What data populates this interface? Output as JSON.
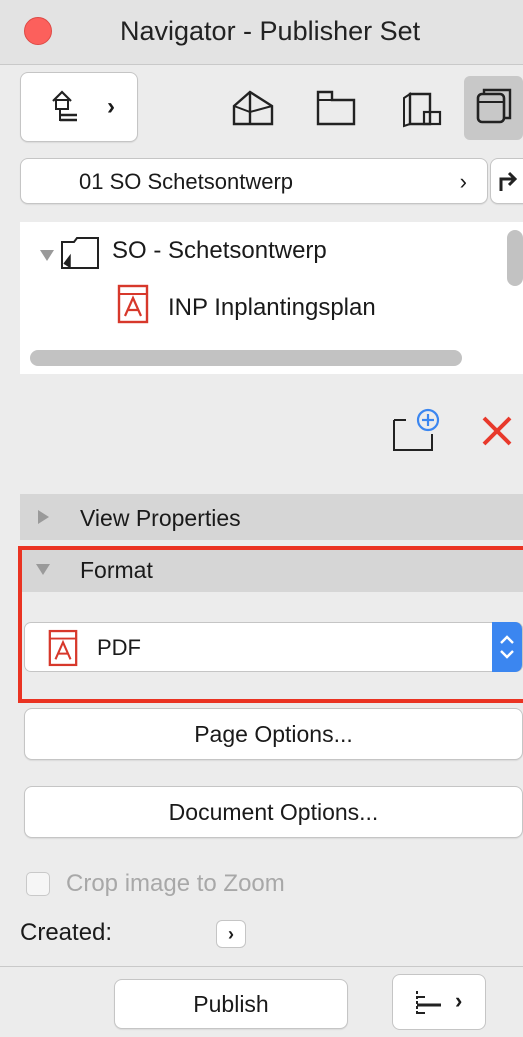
{
  "window": {
    "title": "Navigator - Publisher Set"
  },
  "toolbar": {
    "set_selector_chevron": "›",
    "buttons": [
      {
        "icon": "project-map-icon"
      },
      {
        "icon": "view-map-icon"
      },
      {
        "icon": "layout-book-icon"
      },
      {
        "icon": "publisher-sets-icon",
        "selected": true
      }
    ]
  },
  "publisher_set": {
    "selected": "01 SO Schetsontwerp",
    "chevron": "›"
  },
  "tree": {
    "folder_label": "SO - Schetsontwerp",
    "item_label": "INP Inplantingsplan"
  },
  "sections": {
    "view_properties": "View Properties",
    "format": "Format"
  },
  "format": {
    "selected": "PDF"
  },
  "buttons": {
    "page_options": "Page Options...",
    "document_options": "Document Options...",
    "publish": "Publish",
    "created_arrow": "›",
    "tree_toggle_chevron": "›"
  },
  "options": {
    "crop_label": "Crop image to Zoom",
    "crop_checked": false,
    "created_label": "Created:"
  },
  "colors": {
    "highlight_border": "#ea3322",
    "close_button": "#fc605c",
    "stepper_blue": "#3b86f0",
    "delete_x": "#e8392b"
  }
}
